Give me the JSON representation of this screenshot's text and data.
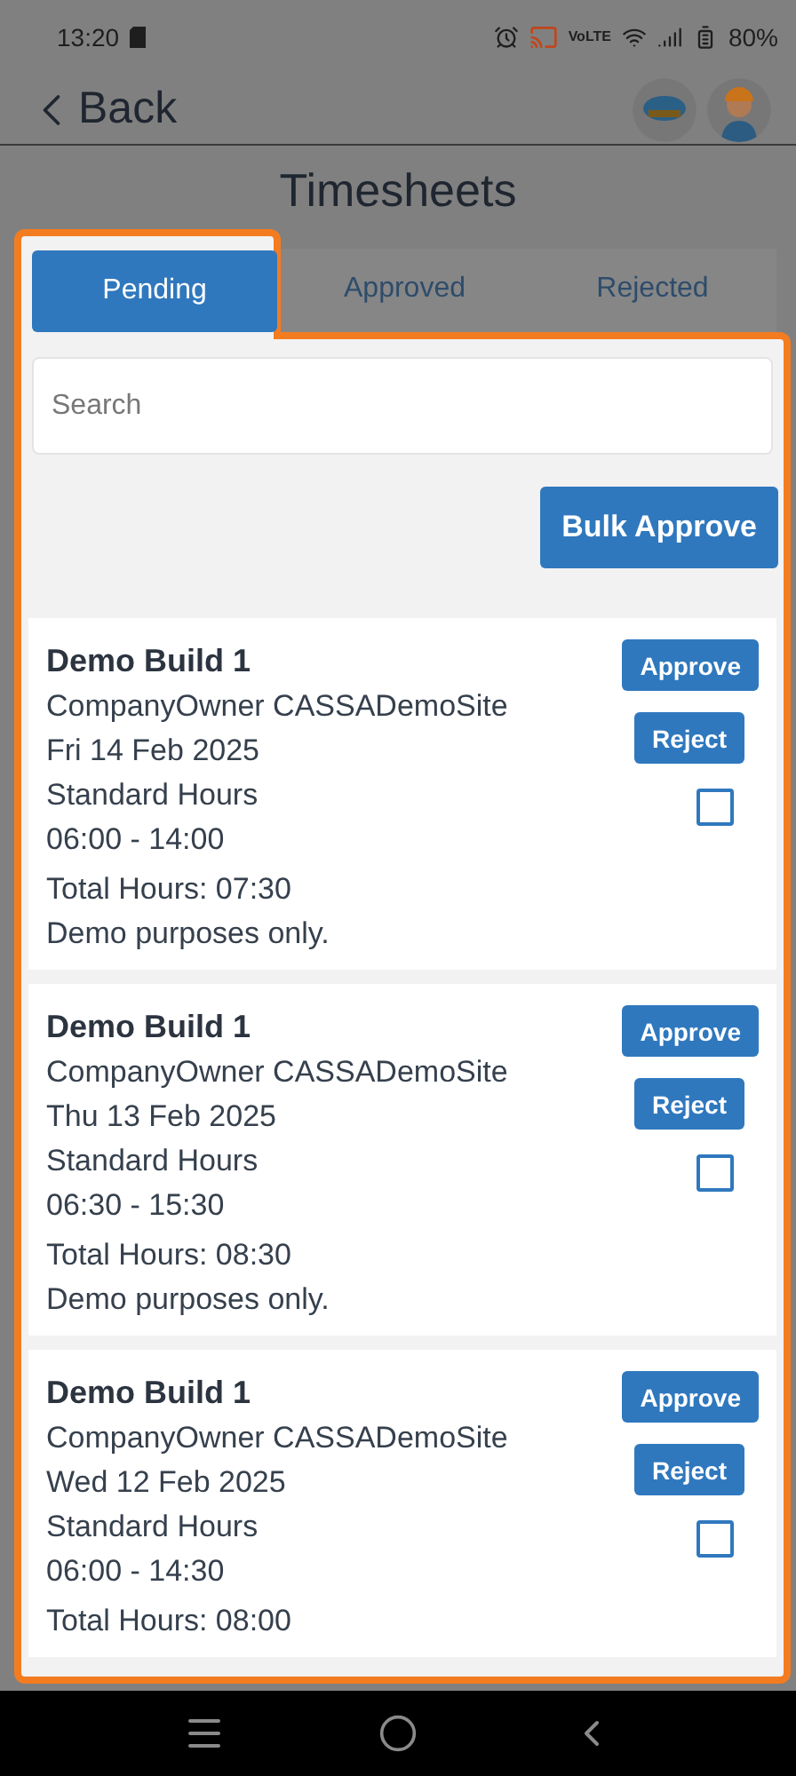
{
  "status_bar": {
    "time": "13:20",
    "network": "VoLTE",
    "battery": "80%"
  },
  "header": {
    "back": "Back"
  },
  "title": "Timesheets",
  "tabs": [
    {
      "label": "Pending",
      "selected": true
    },
    {
      "label": "Approved",
      "selected": false
    },
    {
      "label": "Rejected",
      "selected": false
    }
  ],
  "search": {
    "placeholder": "Search"
  },
  "bulk_button": "Bulk Approve",
  "timesheets": [
    {
      "title": "Demo Build 1",
      "owner": "CompanyOwner CASSADemoSite",
      "date": "Fri 14 Feb 2025",
      "hour_type": "Standard Hours",
      "time_range": "06:00 - 14:00",
      "total": "Total Hours: 07:30",
      "note": "Demo purposes only.",
      "approve": "Approve",
      "reject": "Reject",
      "checked": false
    },
    {
      "title": "Demo Build 1",
      "owner": "CompanyOwner CASSADemoSite",
      "date": "Thu 13 Feb 2025",
      "hour_type": "Standard Hours",
      "time_range": "06:30 - 15:30",
      "total": "Total Hours: 08:30",
      "note": "Demo purposes only.",
      "approve": "Approve",
      "reject": "Reject",
      "checked": false
    },
    {
      "title": "Demo Build 1",
      "owner": "CompanyOwner CASSADemoSite",
      "date": "Wed 12 Feb 2025",
      "hour_type": "Standard Hours",
      "time_range": "06:00 - 14:30",
      "total": "Total Hours: 08:00",
      "approve": "Approve",
      "reject": "Reject",
      "checked": false
    }
  ]
}
